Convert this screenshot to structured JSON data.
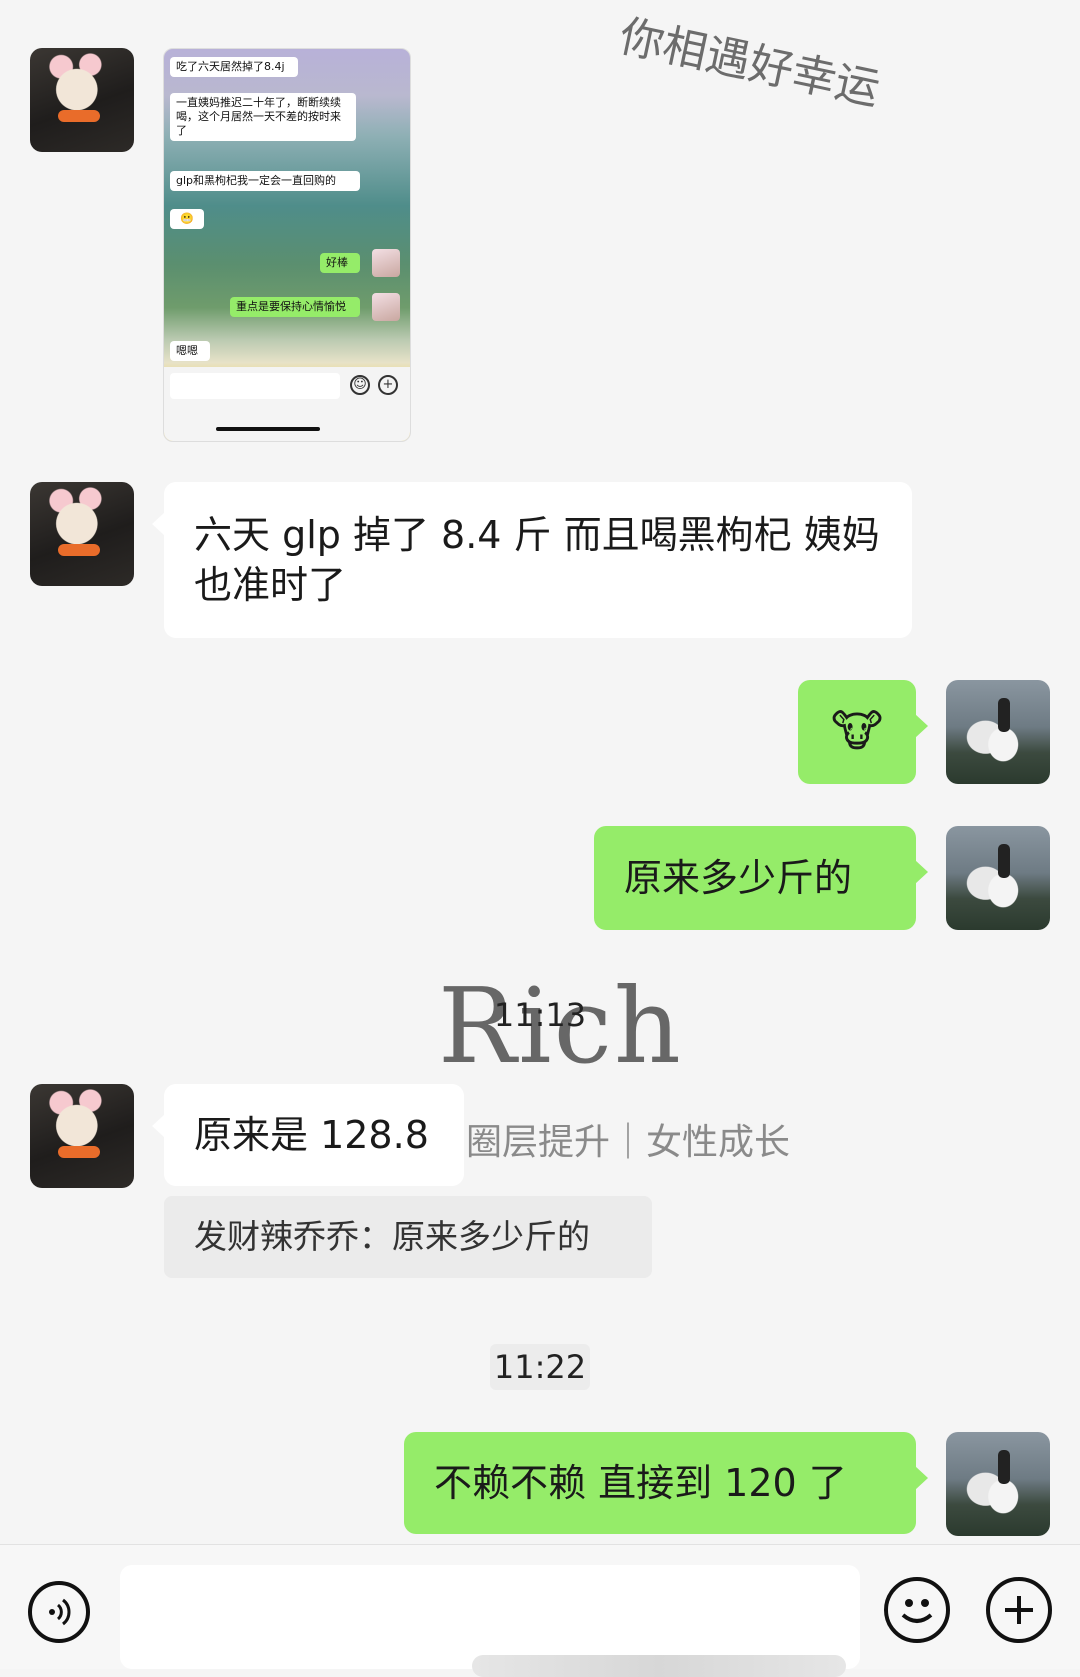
{
  "watermarks": {
    "arc_text": "你相遇好幸运",
    "brand": "Rich",
    "tagline": "圈层提升｜女性成长"
  },
  "embedded_screenshot": {
    "messages": [
      {
        "side": "in",
        "text": "吃了六天居然掉了8.4j"
      },
      {
        "side": "in",
        "text": "一直姨妈推迟二十年了，断断续续喝，这个月居然一天不差的按时来了"
      },
      {
        "side": "in",
        "text": "glp和黑枸杞我一定会一直回购的"
      },
      {
        "side": "in",
        "text": "😬"
      },
      {
        "side": "out",
        "text": "好棒"
      },
      {
        "side": "out",
        "text": "重点是要保持心情愉悦"
      },
      {
        "side": "in",
        "text": "嗯嗯"
      }
    ]
  },
  "messages": {
    "m1": "六天 glp 掉了 8.4 斤 而且喝黑枸杞 姨妈也准时了",
    "m2": "🐮",
    "m3": "原来多少斤的",
    "m4": "原来是 128.8",
    "m4_quote": "发财辣乔乔：原来多少斤的",
    "m5": "不赖不赖 直接到 120 了"
  },
  "timestamps": {
    "t1": "11:13",
    "t2": "11:22"
  },
  "colors": {
    "background": "#f5f5f5",
    "outgoing_bubble": "#95ec69",
    "incoming_bubble": "#ffffff"
  },
  "input_bar": {
    "voice_icon": "voice-icon",
    "emoji_icon": "emoji-icon",
    "plus_icon": "plus-icon"
  }
}
